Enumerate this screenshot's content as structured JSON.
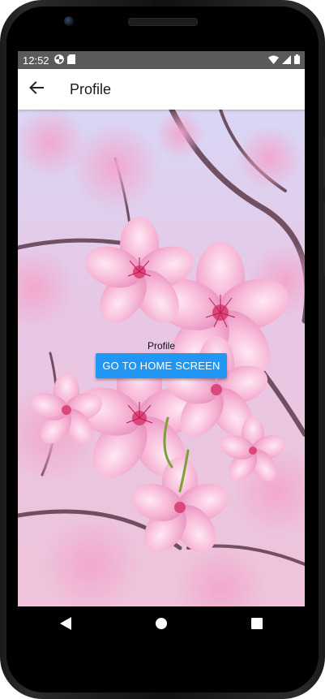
{
  "status_bar": {
    "time": "12:52",
    "left_icons": [
      "data-saver-icon",
      "sd-card-icon"
    ],
    "right_icons": [
      "wifi-icon",
      "cellular-signal-icon",
      "battery-icon"
    ]
  },
  "app_bar": {
    "title": "Profile",
    "back_icon": "arrow-back-icon"
  },
  "content": {
    "background": "cherry-blossom-photo",
    "label": "Profile",
    "button_label": "GO TO HOME SCREEN"
  },
  "nav_bar": {
    "buttons": [
      "back-triangle-icon",
      "home-circle-icon",
      "recents-square-icon"
    ]
  },
  "colors": {
    "accent": "#2196f3",
    "app_bar_bg": "#ffffff",
    "status_bar_bg": "#5a5a5a",
    "nav_bar_bg": "#000000"
  }
}
